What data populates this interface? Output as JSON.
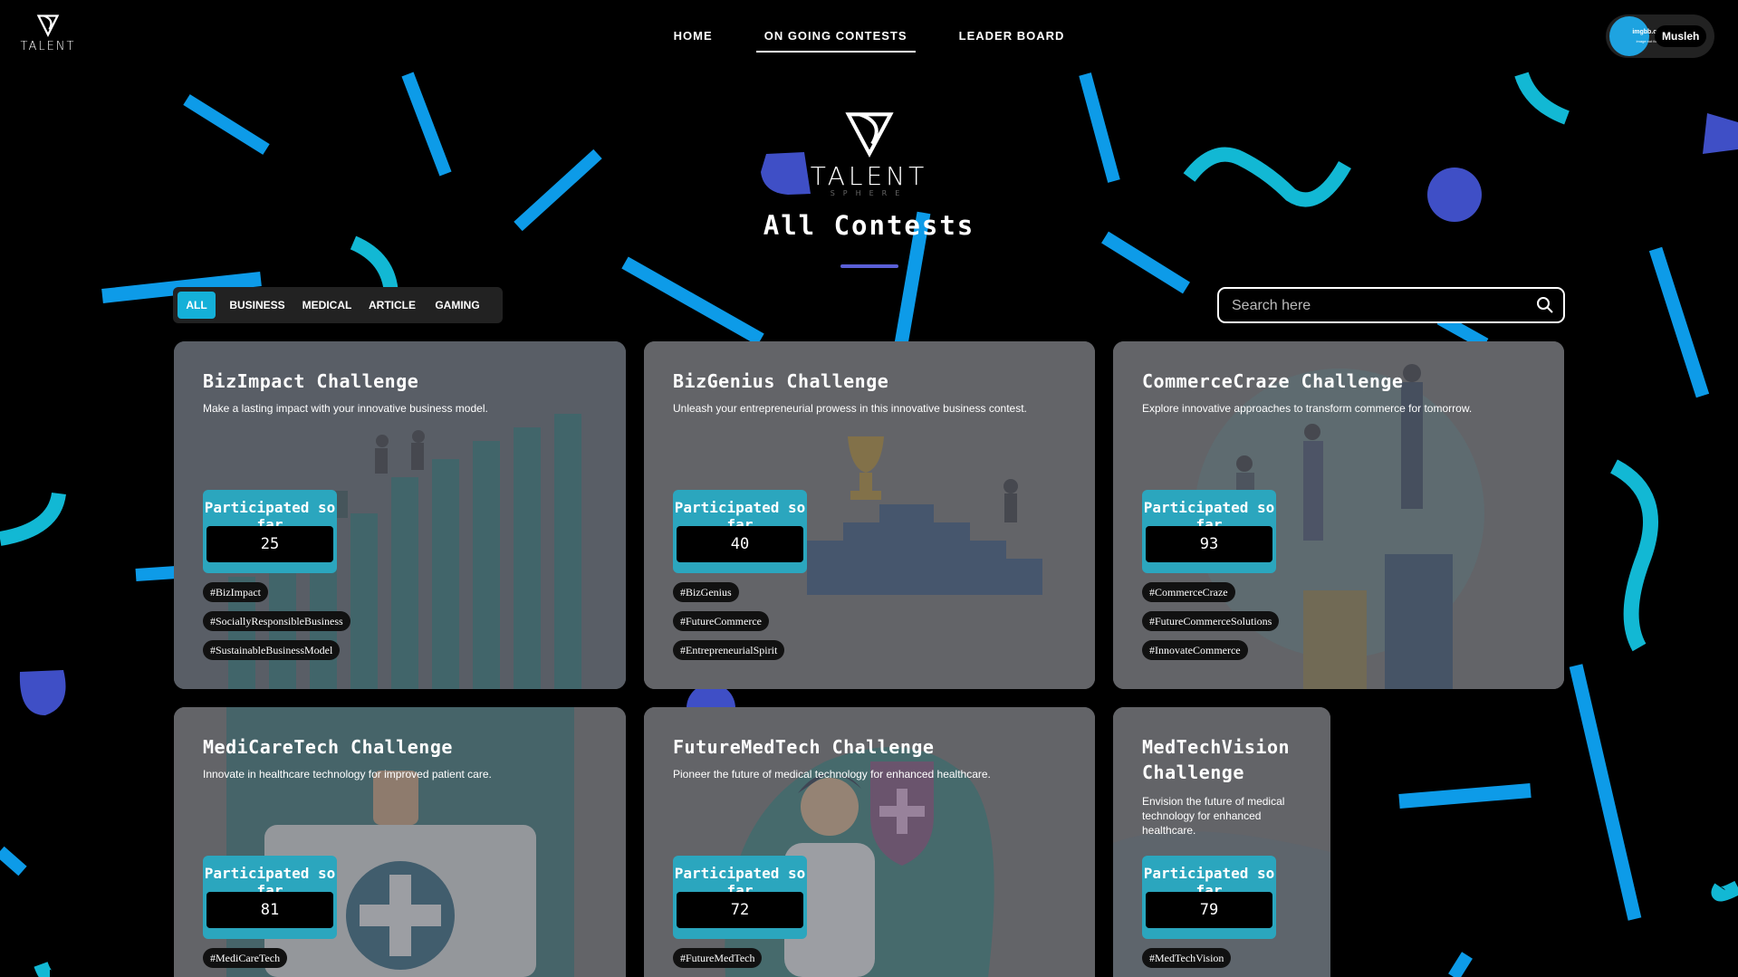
{
  "brand": {
    "wordmark": "TALENT",
    "tagline": "SPHERE"
  },
  "nav": {
    "home": "HOME",
    "ongoing": "ON GOING CONTESTS",
    "leaderboard": "LEADER BOARD"
  },
  "user": {
    "avatar_text": "imgbb.com",
    "avatar_subtext": "image not found",
    "name": "Musleh"
  },
  "page": {
    "title": "All Contests"
  },
  "filters": {
    "tabs": [
      "ALL",
      "BUSINESS",
      "MEDICAL",
      "ARTICLE",
      "GAMING"
    ],
    "active": "ALL"
  },
  "search": {
    "placeholder": "Search here"
  },
  "participated_label": "Participated so far",
  "contests": [
    {
      "title": "BizImpact Challenge",
      "description": "Make a lasting impact with your innovative business model.",
      "participants": "25",
      "tags": [
        "#BizImpact",
        "#SociallyResponsibleBusiness",
        "#SustainableBusinessModel"
      ]
    },
    {
      "title": "BizGenius Challenge",
      "description": "Unleash your entrepreneurial prowess in this innovative business contest.",
      "participants": "40",
      "tags": [
        "#BizGenius",
        "#FutureCommerce",
        "#EntrepreneurialSpirit"
      ]
    },
    {
      "title": "CommerceCraze Challenge",
      "description": "Explore innovative approaches to transform commerce for tomorrow.",
      "participants": "93",
      "tags": [
        "#CommerceCraze",
        "#FutureCommerceSolutions",
        "#InnovateCommerce"
      ]
    },
    {
      "title": "MediCareTech Challenge",
      "description": "Innovate in healthcare technology for improved patient care.",
      "participants": "81",
      "tags": [
        "#MediCareTech"
      ]
    },
    {
      "title": "FutureMedTech Challenge",
      "description": "Pioneer the future of medical technology for enhanced healthcare.",
      "participants": "72",
      "tags": [
        "#FutureMedTech"
      ]
    },
    {
      "title": "MedTechVision Challenge",
      "description": "Envision the future of medical technology for enhanced healthcare.",
      "participants": "79",
      "tags": [
        "#MedTechVision"
      ]
    }
  ],
  "colors": {
    "background": "#000000",
    "accent": "#14b0d8",
    "confetti_blue": "#0d9be8",
    "confetti_cyan": "#12b8d4",
    "confetti_indigo": "#3f4fc6",
    "card": "#5c5d63"
  }
}
